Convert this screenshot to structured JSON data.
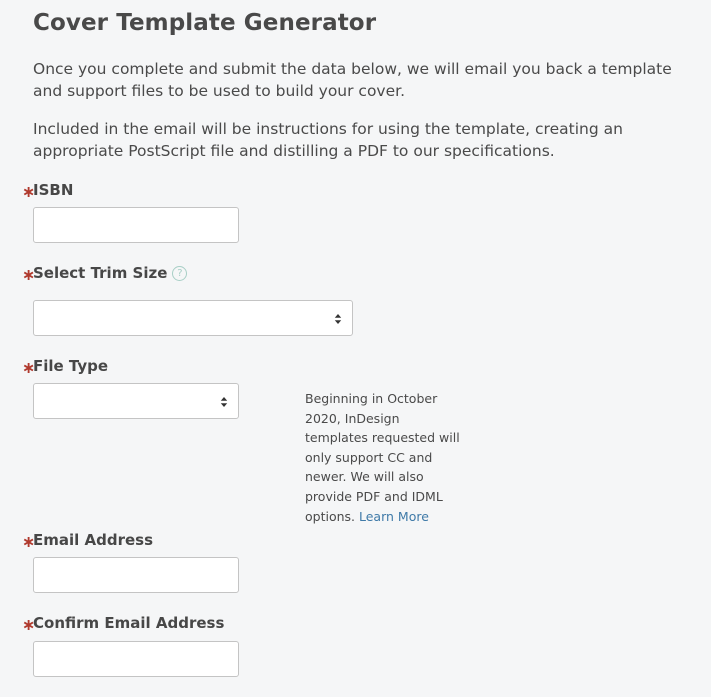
{
  "page": {
    "title": "Cover Template Generator",
    "intro_1": "Once you complete and submit the data below, we will email you back a template and support files to be used to build your cover.",
    "intro_2": "Included in the email will be instructions for using the template, creating an appropriate PostScript file and distilling a PDF to our specifications."
  },
  "form": {
    "required_marker": "∗",
    "isbn": {
      "label": "ISBN",
      "value": ""
    },
    "trim_size": {
      "label": "Select Trim Size",
      "help_icon": "question-circle-icon",
      "value": ""
    },
    "file_type": {
      "label": "File Type",
      "value": "",
      "note": "Beginning in October 2020, InDesign templates requested will only support CC and newer. We will also provide PDF and IDML options.",
      "note_link": "Learn More"
    },
    "email": {
      "label": "Email Address",
      "value": ""
    },
    "confirm_email": {
      "label": "Confirm Email Address",
      "value": ""
    }
  },
  "colors": {
    "background": "#f5f6f7",
    "required": "#b03a2e",
    "link": "#3f7aa8",
    "help_icon": "#a8cfc6"
  }
}
